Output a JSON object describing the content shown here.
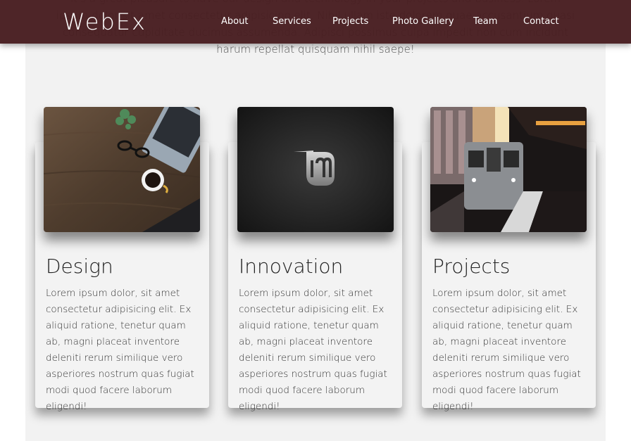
{
  "nav": {
    "brand": "WebEx",
    "links": [
      "About",
      "Services",
      "Projects",
      "Photo Gallery",
      "Team",
      "Contact"
    ]
  },
  "intro": {
    "text": "It's a great pleasure to have our design and technology in your projects and business. Lorem ipsum dolor sit amet consectetur adipisicing elit. Nihil ullam iste dolorem quae accusantium quasi consequatur cupiditate ducimus assumenda. Adipisci possimus culpa impedit non cum incidunt harum repellat quisquam nihil saepe!"
  },
  "cards": [
    {
      "title": "Design",
      "image": "desk-laptop-coffee-photo",
      "text": "Lorem ipsum dolor, sit amet consectetur adipisicing elit. Ex aliquid ratione, tenetur quam ab, magni placeat inventore deleniti rerum similique vero asperiores nostrum quas fugiat modi quod facere laborum eligendi!"
    },
    {
      "title": "Innovation",
      "image": "linux-mint-logo-photo",
      "text": "Lorem ipsum dolor, sit amet consectetur adipisicing elit. Ex aliquid ratione, tenetur quam ab, magni placeat inventore deleniti rerum similique vero asperiores nostrum quas fugiat modi quod facere laborum eligendi!"
    },
    {
      "title": "Projects",
      "image": "subway-train-photo",
      "text": "Lorem ipsum dolor, sit amet consectetur adipisicing elit. Ex aliquid ratione, tenetur quam ab, magni placeat inventore deleniti rerum similique vero asperiores nostrum quas fugiat modi quod facere laborum eligendi!"
    }
  ],
  "colors": {
    "navbar": "#481e21",
    "section_bg": "#f2f2f2",
    "card_bg": "#f3f3f3"
  }
}
